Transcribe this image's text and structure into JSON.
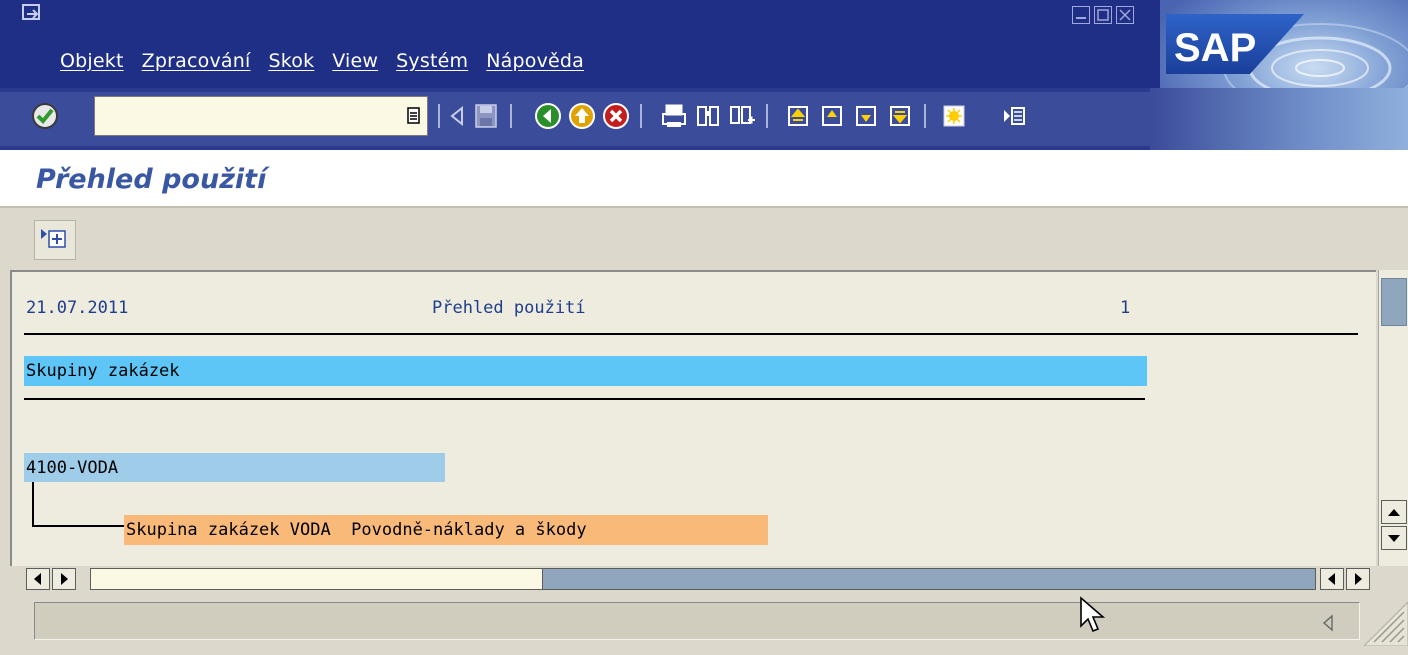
{
  "window": {
    "menu": [
      "Objekt",
      "Zpracování",
      "Skok",
      "View",
      "Systém",
      "Nápověda"
    ],
    "brand": "SAP"
  },
  "toolbar": {
    "command_value": ""
  },
  "title": "Přehled použití",
  "report": {
    "date": "21.07.2011",
    "heading": "Přehled použití",
    "page": "1",
    "section": "Skupiny zakázek",
    "node": "4100-VODA",
    "child": "Skupina zakázek VODA  Povodně-náklady a škody"
  },
  "colors": {
    "menubar": "#1f2f86",
    "section_highlight": "#5ec6f7",
    "node_highlight": "#9fcde9",
    "child_highlight": "#f8b979",
    "title_text": "#3a57a4"
  }
}
